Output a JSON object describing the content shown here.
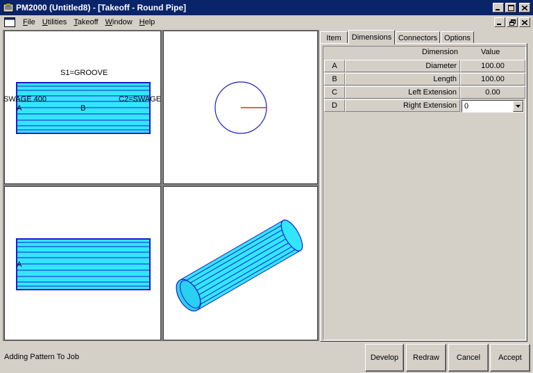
{
  "window": {
    "title": "PM2000 (Untitled8) - [Takeoff - Round Pipe]"
  },
  "menu": {
    "items": [
      {
        "label": "File",
        "accel": "F",
        "rest": "ile"
      },
      {
        "label": "Utilities",
        "accel": "U",
        "rest": "tilities"
      },
      {
        "label": "Takeoff",
        "accel": "T",
        "rest": "akeoff"
      },
      {
        "label": "Window",
        "accel": "W",
        "rest": "indow"
      },
      {
        "label": "Help",
        "accel": "H",
        "rest": "elp"
      }
    ]
  },
  "views": {
    "front": {
      "top_label": "S1=GROOVE",
      "left_label": "SWAGE 400",
      "right_label": "C2=SWAGE",
      "point_a": "A",
      "point_b": "B"
    },
    "side_bottom": {
      "point_a": "A"
    }
  },
  "tabs": [
    {
      "label": "Item",
      "active": false
    },
    {
      "label": "Dimensions",
      "active": true
    },
    {
      "label": "Connectors",
      "active": false
    },
    {
      "label": "Options",
      "active": false
    }
  ],
  "dimensions": {
    "headers": {
      "dimension": "Dimension",
      "value": "Value"
    },
    "rows": [
      {
        "key": "A",
        "name": "Diameter",
        "value": "100.00"
      },
      {
        "key": "B",
        "name": "Length",
        "value": "100.00"
      },
      {
        "key": "C",
        "name": "Left Extension",
        "value": "0.00"
      },
      {
        "key": "D",
        "name": "Right Extension",
        "value": "0"
      }
    ]
  },
  "status": {
    "message": "Adding Pattern To Job"
  },
  "buttons": {
    "develop": "Develop",
    "redraw": "Redraw",
    "cancel": "Cancel",
    "accept": "Accept"
  },
  "colors": {
    "titlebar": "#0a246a",
    "pipe_fill": "#33e6ff",
    "pipe_line": "#1a1acc",
    "face": "#d4d0c8",
    "radius_line": "#cc0000"
  }
}
